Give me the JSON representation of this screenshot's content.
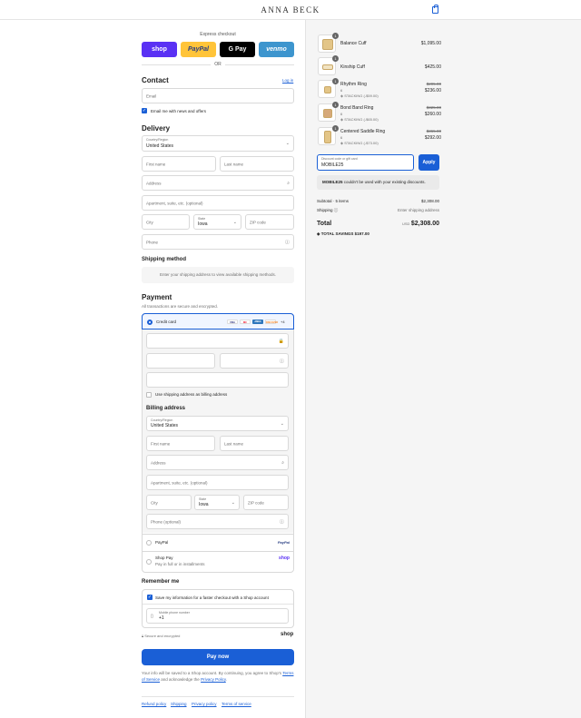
{
  "header": {
    "brand": "ANNA BECK",
    "cart_icon": "shopping-bag-icon"
  },
  "express": {
    "title": "Express checkout",
    "buttons": [
      {
        "label": "shop",
        "bg": "#5a31f4",
        "fg": "#ffffff"
      },
      {
        "label": "PayPal",
        "bg": "#ffc439",
        "fg": "#253b80"
      },
      {
        "label": "G Pay",
        "bg": "#000000",
        "fg": "#ffffff"
      },
      {
        "label": "venmo",
        "bg": "#3d95ce",
        "fg": "#ffffff"
      }
    ],
    "or": "OR"
  },
  "contact": {
    "title": "Contact",
    "login": "Log in",
    "email_placeholder": "Email",
    "newsletter_label": "Email me with news and offers"
  },
  "delivery": {
    "title": "Delivery",
    "country_label": "Country/Region",
    "country_value": "United States",
    "first_name": "First name",
    "last_name": "Last name",
    "address": "Address",
    "apartment": "Apartment, suite, etc. (optional)",
    "city": "City",
    "state_label": "State",
    "state_value": "Iowa",
    "zip": "ZIP code",
    "phone": "Phone"
  },
  "shipping_method": {
    "title": "Shipping method",
    "message": "Enter your shipping address to view available shipping methods."
  },
  "payment": {
    "title": "Payment",
    "subtitle": "All transactions are secure and encrypted.",
    "credit_card_label": "Credit card",
    "cards": [
      "VISA",
      "MC",
      "AMEX",
      "DISCOVER"
    ],
    "more_cards": "+4",
    "use_shipping_label": "Use shipping address as billing address",
    "billing_title": "Billing address",
    "billing": {
      "country_label": "Country/Region",
      "country_value": "United States",
      "first_name": "First name",
      "last_name": "Last name",
      "address": "Address",
      "apartment": "Apartment, suite, etc. (optional)",
      "city": "City",
      "state_label": "State",
      "state_value": "Iowa",
      "zip": "ZIP code",
      "phone": "Phone (optional)"
    },
    "paypal_label": "PayPal",
    "paypal_logo": "PayPal",
    "shoppay_label": "Shop Pay",
    "shoppay_sub": "Pay in full or in installments",
    "shoppay_logo": "shop"
  },
  "remember": {
    "title": "Remember me",
    "save_label": "Save my information for a faster checkout with a Shop account",
    "phone_label": "Mobile phone number",
    "phone_value": "+1",
    "secure": "Secure and encrypted",
    "shop_logo": "shop"
  },
  "pay_now": "Pay now",
  "legal": {
    "text": "Your info will be saved to a Shop account. By continuing, you agree to Shop's",
    "terms": "Terms of Service",
    "and": "and acknowledge the",
    "privacy": "Privacy Policy",
    "end": "."
  },
  "footer_links": [
    "Refund policy",
    "Shipping",
    "Privacy policy",
    "Terms of service"
  ],
  "order": {
    "items": [
      {
        "name": "Balance Cuff",
        "qty": "1",
        "price": "$1,095.00",
        "orig": "",
        "variant": "",
        "discount": ""
      },
      {
        "name": "Kinship Cuff",
        "qty": "1",
        "price": "$425.00",
        "orig": "",
        "variant": "",
        "discount": ""
      },
      {
        "name": "Rhythm Ring",
        "qty": "1",
        "price": "$236.00",
        "orig": "$295.00",
        "variant": "6",
        "discount": "STACKING (-$59.00)"
      },
      {
        "name": "Bond Band Ring",
        "qty": "1",
        "price": "$260.00",
        "orig": "$325.00",
        "variant": "6",
        "discount": "STACKING (-$65.00)"
      },
      {
        "name": "Centered Saddle Ring",
        "qty": "1",
        "price": "$292.00",
        "orig": "$365.00",
        "variant": "6",
        "discount": "STACKING (-$73.00)"
      }
    ],
    "discount_label": "Discount code or gift card",
    "discount_value": "MOBILE25",
    "apply": "Apply",
    "error_code": "MOBILE25",
    "error_text": "couldn't be used with your existing discounts.",
    "subtotal_label": "Subtotal · 5 items",
    "subtotal_value": "$2,308.00",
    "shipping_label": "Shipping",
    "shipping_value": "Enter shipping address",
    "total_label": "Total",
    "currency": "USD",
    "total_value": "$2,308.00",
    "savings_label": "TOTAL SAVINGS",
    "savings_value": "$197.00"
  },
  "colors": {
    "accent": "#1a5fd6",
    "text": "#1f1f1f",
    "muted": "#707070",
    "border": "#d9d9d9"
  }
}
